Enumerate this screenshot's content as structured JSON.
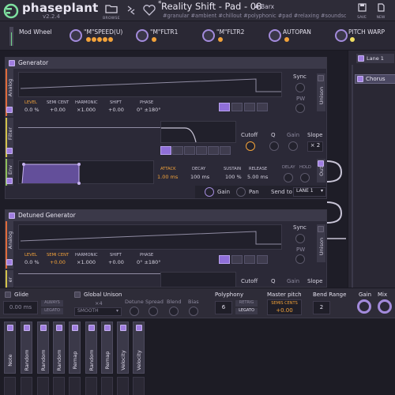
{
  "header": {
    "app_name": "phaseplant",
    "version": "v2.2.4",
    "browse_label": "BROWSE",
    "preset_name": "Reality Shift - Pad - 08",
    "modified_marker": "*",
    "author": "Barx",
    "tags": "#granular #ambient #chillout #polyphonic #pad #relaxing #soundsc",
    "save_label": "SAVE",
    "new_label": "NEW"
  },
  "macros": [
    {
      "label": "Mod Wheel"
    },
    {
      "label": "\"M\"SPEED(U)"
    },
    {
      "label": "\"M\"FLTR1"
    },
    {
      "label": "\"M\"FLTR2"
    },
    {
      "label": "AUTOPAN"
    },
    {
      "label": "PITCH WARP"
    }
  ],
  "generator1": {
    "title": "Generator",
    "analog_tab": "Analog",
    "filter_tab": "Filter",
    "env_tab": "Env",
    "level_label": "LEVEL",
    "level_value": "0.0 %",
    "semi_label": "SEMI CENT",
    "semi_value": "+0.00",
    "harmonic_label": "HARMONIC",
    "harmonic_value": "×1.000",
    "shift_label": "SHIFT",
    "shift_value": "+0.00",
    "phase_label": "PHASE",
    "phase_value": "0° ±180°",
    "sync_label": "Sync",
    "pw_label": "PW",
    "unison_label": "Unison",
    "cutoff_label": "Cutoff",
    "q_label": "Q",
    "gain_label": "Gain",
    "slope_label": "Slope",
    "slope_value": "× 2",
    "attack_label": "ATTACK",
    "attack_value": "1.00 ms",
    "decay_label": "DECAY",
    "decay_value": "100 ms",
    "sustain_label": "SUSTAIN",
    "sustain_value": "100 %",
    "release_label": "RELEASE",
    "release_value": "5.00 ms",
    "delay_label": "DELAY",
    "hold_label": "HOLD",
    "out_label": "Out",
    "out_gain_label": "Gain",
    "pan_label": "Pan",
    "send_label": "Send to",
    "send_value": "LANE 1"
  },
  "generator2": {
    "title": "Detuned Generator",
    "analog_tab": "Analog",
    "level_label": "LEVEL",
    "level_value": "0.0 %",
    "semi_label": "SEMI CENT",
    "semi_value": "+0.00",
    "harmonic_label": "HARMONIC",
    "harmonic_value": "×1.000",
    "shift_label": "SHIFT",
    "shift_value": "+0.00",
    "phase_label": "PHASE",
    "phase_value": "0° ±180°",
    "sync_label": "Sync",
    "pw_label": "PW",
    "unison_label": "Unison",
    "cutoff_label": "Cutoff",
    "q_label": "Q",
    "gain_label": "Gain",
    "slope_label": "Slope",
    "partial_tab": "er"
  },
  "lanes": {
    "lane_label": "Lane 1",
    "effect_label": "Chorus"
  },
  "bottom": {
    "glide_label": "Glide",
    "glide_value": "0.00 ms",
    "always_tag": "ALWAYS",
    "legato_tag": "LEGATO",
    "unison_label": "Global Unison",
    "unison_voices": "×4",
    "unison_mode": "SMOOTH",
    "detune_label": "Detune",
    "spread_label": "Spread",
    "blend_label": "Blend",
    "bias_label": "Bias",
    "polyphony_label": "Polyphony",
    "polyphony_value": "6",
    "retrig_tag": "RETRIG",
    "poly_legato_tag": "LEGATO",
    "master_pitch_label": "Master pitch",
    "semis_cents_tag": "SEMIS CENTS",
    "master_pitch_value": "+0.00",
    "bend_label": "Bend Range",
    "bend_value": "2",
    "gain_label": "Gain",
    "mix_label": "Mix"
  },
  "modulators": [
    {
      "label": "Note"
    },
    {
      "label": "Random"
    },
    {
      "label": "Random"
    },
    {
      "label": "Random"
    },
    {
      "label": "Remap"
    },
    {
      "label": "Random"
    },
    {
      "label": "Remap"
    },
    {
      "label": "Velocity"
    },
    {
      "label": "Velocity"
    }
  ],
  "colors": {
    "accent": "#a07ee0",
    "orange": "#f2a23a",
    "green": "#72d48a",
    "analog_stripe": "#e06a3a",
    "filter_stripe": "#d2c24a",
    "env_stripe": "#8fbf5a"
  }
}
